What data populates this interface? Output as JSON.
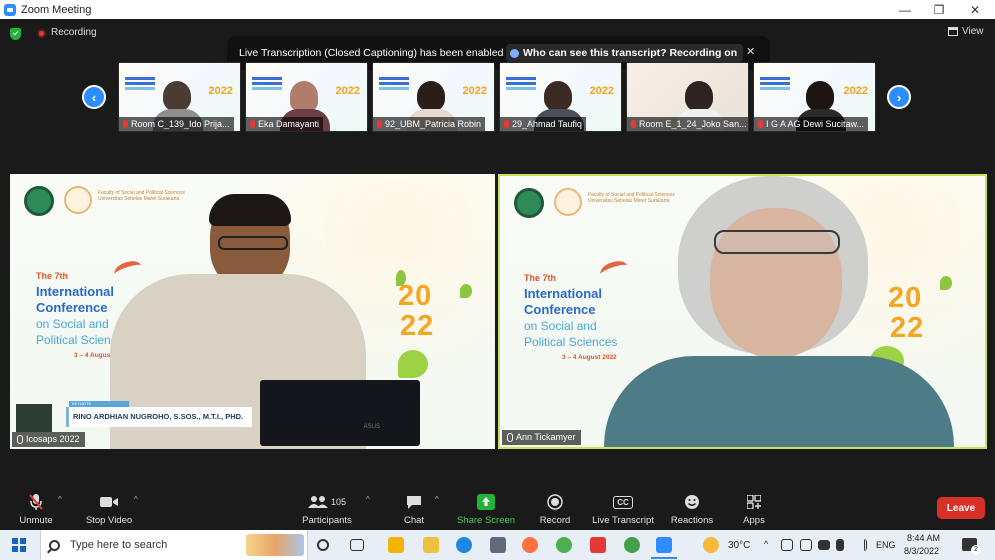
{
  "window": {
    "title": "Zoom Meeting",
    "controls": {
      "minimize": "—",
      "restore": "❐",
      "close": "✕"
    }
  },
  "status": {
    "recording_label": "Recording",
    "view_label": "View"
  },
  "banner": {
    "text": "Live Transcription (Closed Captioning) has been enabled",
    "link": "Who can see this transcript? Recording on",
    "close": "✕"
  },
  "gallery": {
    "prev": "‹",
    "next": "›",
    "year": "2022",
    "participants": [
      {
        "name": "Room C_139_Ido Prija..."
      },
      {
        "name": "Eka Damayanti"
      },
      {
        "name": "92_UBM_Patricia Robin"
      },
      {
        "name": "29_Ahmad Taufiq"
      },
      {
        "name": "Room E_1_24_Joko San..."
      },
      {
        "name": "I G A AG Dewi Sucitaw..."
      }
    ]
  },
  "videos": {
    "left": {
      "label": "Icosaps 2022",
      "caption_tag": "KEYNOTE",
      "speaker_caption": "RINO ARDHIAN NUGROHO, S.SOS., M.T.I., PHD.",
      "laptop_brand": "ASUS"
    },
    "right": {
      "label": "Ann Tickamyer"
    },
    "slide": {
      "faculty": "Faculty of Social and Political Sciences Universitas Sebelas Maret Surakarta",
      "ordinal": "The 7th",
      "line1": "International",
      "line2": "Conference",
      "line3": "on Social and",
      "line4": "Political Sciences",
      "dates": "3 – 4 August 2022",
      "year_top": "20",
      "year_bottom": "22"
    }
  },
  "toolbar": {
    "unmute": "Unmute",
    "stop_video": "Stop Video",
    "participants": "Participants",
    "participants_count": "105",
    "chat": "Chat",
    "share_screen": "Share Screen",
    "record": "Record",
    "live_transcript": "Live Transcript",
    "cc": "CC",
    "reactions": "Reactions",
    "apps": "Apps",
    "leave": "Leave",
    "chevron": "^"
  },
  "taskbar": {
    "search_placeholder": "Type here to search",
    "temperature": "30°C",
    "language": "ENG",
    "time": "8:44 AM",
    "date": "8/3/2022",
    "notifications": "2"
  },
  "colors": {
    "zoom_blue": "#2d8cff",
    "share_green": "#23b33a",
    "leave_red": "#d93025",
    "active_border": "#c9e35a"
  }
}
